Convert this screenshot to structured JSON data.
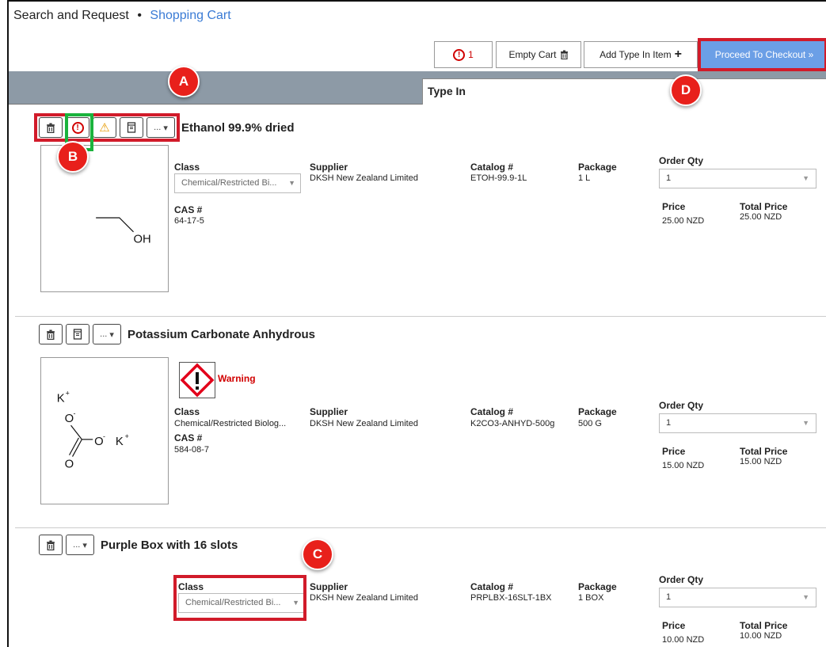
{
  "breadcrumb": {
    "root": "Search and Request",
    "separator": "•",
    "current": "Shopping Cart"
  },
  "toolbar": {
    "alert_count": "1",
    "empty_cart_label": "Empty Cart",
    "add_type_in_label": "Add Type In Item",
    "checkout_label": "Proceed To Checkout »"
  },
  "tabs": {
    "type_in": "Type In"
  },
  "markers": {
    "a": "A",
    "b": "B",
    "c": "C",
    "d": "D"
  },
  "labels": {
    "class": "Class",
    "supplier": "Supplier",
    "catalog": "Catalog #",
    "package": "Package",
    "order_qty": "Order Qty",
    "price": "Price",
    "total_price": "Total Price",
    "cas": "CAS #",
    "more": "...",
    "warning": "Warning"
  },
  "items": [
    {
      "title": "Ethanol 99.9% dried",
      "class_value": "Chemical/Restricted Bi...",
      "supplier": "DKSH New Zealand Limited",
      "catalog": "ETOH-99.9-1L",
      "package": "1 L",
      "cas": "64-17-5",
      "qty": "1",
      "price": "25.00 NZD",
      "total_price": "25.00 NZD",
      "struct_labels": [
        "OH"
      ]
    },
    {
      "title": "Potassium Carbonate Anhydrous",
      "class_value": "Chemical/Restricted Biolog...",
      "supplier": "DKSH New Zealand Limited",
      "catalog": "K2CO3-ANHYD-500g",
      "package": "500 G",
      "cas": "584-08-7",
      "qty": "1",
      "price": "15.00 NZD",
      "total_price": "15.00 NZD",
      "struct_labels": [
        "K",
        "+",
        "O",
        "-",
        "O",
        "-",
        "K",
        "+",
        "O"
      ]
    },
    {
      "title": "Purple Box with 16 slots",
      "class_value": "Chemical/Restricted Bi...",
      "supplier": "DKSH New Zealand Limited",
      "catalog": "PRPLBX-16SLT-1BX",
      "package": "1 BOX",
      "qty": "1",
      "price": "10.00 NZD",
      "total_price": "10.00 NZD"
    }
  ],
  "colors": {
    "highlight_red": "#d11b2a",
    "highlight_green": "#1bb33d",
    "checkout_blue": "#6b9fe6",
    "tab_bar": "#8d9aa6",
    "link_blue": "#3a7bd5"
  }
}
